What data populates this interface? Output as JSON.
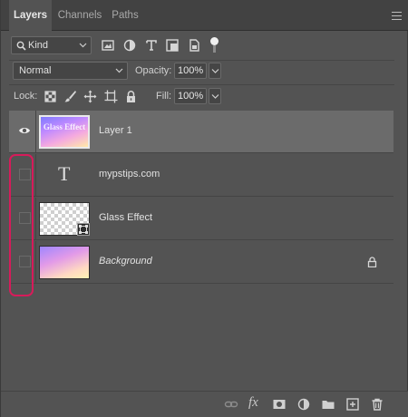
{
  "tabs": [
    {
      "label": "Layers",
      "active": true
    },
    {
      "label": "Channels",
      "active": false
    },
    {
      "label": "Paths",
      "active": false
    }
  ],
  "filter": {
    "kind_label": "Kind",
    "icons": [
      "image-filter-icon",
      "adjustment-filter-icon",
      "type-filter-icon",
      "shape-filter-icon",
      "smart-object-filter-icon",
      "filter-toggle-icon"
    ]
  },
  "blend": {
    "mode": "Normal",
    "opacity_label": "Opacity:",
    "opacity_value": "100%"
  },
  "lock": {
    "label": "Lock:",
    "fill_label": "Fill:",
    "fill_value": "100%",
    "icons": [
      "lock-transparent-icon",
      "lock-image-icon",
      "lock-position-icon",
      "lock-artboard-icon",
      "lock-all-icon"
    ]
  },
  "layers": [
    {
      "name": "Layer 1",
      "visible": true,
      "selected": true,
      "thumb_text": "Glass Effect"
    },
    {
      "name": "mypstips.com",
      "visible": false,
      "selected": false,
      "type_glyph": "T"
    },
    {
      "name": "Glass Effect",
      "visible": false,
      "selected": false
    },
    {
      "name": "Background",
      "visible": false,
      "selected": false,
      "locked": true
    }
  ],
  "footer": {
    "fx_label": "fx",
    "icons": [
      "link-layers-icon",
      "layer-style-icon",
      "add-mask-icon",
      "adjustment-layer-icon",
      "new-group-icon",
      "new-layer-icon",
      "delete-layer-icon"
    ]
  },
  "colors": {
    "panel_bg": "#535353",
    "selected_row": "#6b6b6b",
    "highlight": "#d71b5a"
  }
}
